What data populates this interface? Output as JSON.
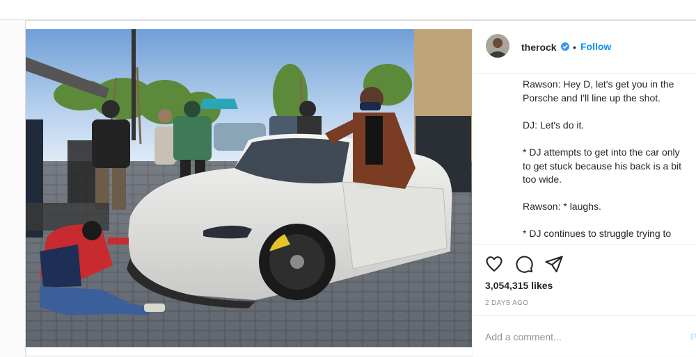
{
  "header": {
    "username": "therock",
    "separator": "•",
    "follow_label": "Follow"
  },
  "caption": {
    "lines": [
      "Rawson: Hey D, let's get you in the Porsche and I'll line up the shot.",
      "DJ: Let's do it.",
      "* DJ attempts to get into the car only to get stuck because his back is a bit too wide.",
      "Rawson: * laughs.",
      "* DJ continues to struggle trying to shimmy into this Porsche like a hi"
    ]
  },
  "actions": {
    "like_icon": "heart-icon",
    "comment_icon": "speech-bubble-icon",
    "share_icon": "paper-plane-icon"
  },
  "likes_text": "3,054,315 likes",
  "timestamp": "2 DAYS AGO",
  "comment": {
    "placeholder": "Add a comment...",
    "post_label": "P"
  },
  "colors": {
    "accent": "#0095f6",
    "verified": "#3897f0",
    "border": "#dbdbdb",
    "car": "#e9e9e6"
  }
}
